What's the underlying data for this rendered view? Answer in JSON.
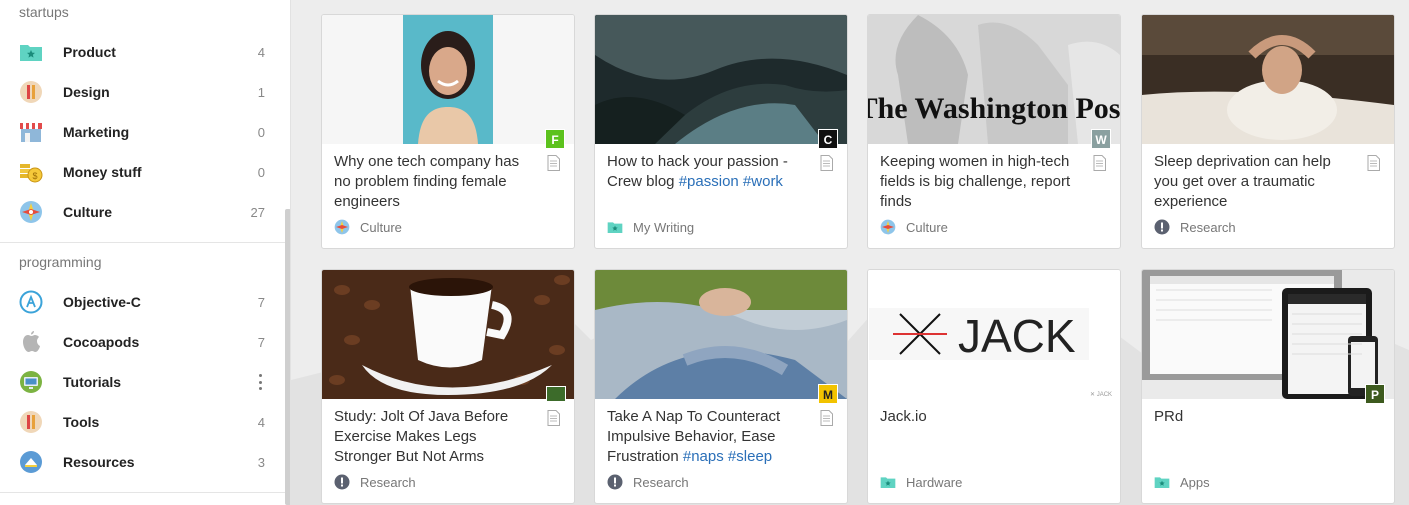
{
  "sidebar": {
    "sections": [
      {
        "header": "startups",
        "items": [
          {
            "label": "Product",
            "count": "4",
            "icon": "folder-star-icon"
          },
          {
            "label": "Design",
            "count": "1",
            "icon": "design-icon"
          },
          {
            "label": "Marketing",
            "count": "0",
            "icon": "storefront-icon"
          },
          {
            "label": "Money stuff",
            "count": "0",
            "icon": "coins-icon"
          },
          {
            "label": "Culture",
            "count": "27",
            "icon": "culture-icon"
          }
        ]
      },
      {
        "header": "programming",
        "items": [
          {
            "label": "Objective-C",
            "count": "7",
            "icon": "app-store-icon"
          },
          {
            "label": "Cocoapods",
            "count": "7",
            "icon": "apple-icon"
          },
          {
            "label": "Tutorials",
            "count": "",
            "icon": "monitor-icon"
          },
          {
            "label": "Tools",
            "count": "4",
            "icon": "tools-icon"
          },
          {
            "label": "Resources",
            "count": "3",
            "icon": "resources-icon"
          }
        ]
      }
    ]
  },
  "cards": [
    {
      "title": "Why one tech company has no problem finding female engineers",
      "tags": [],
      "badge": "F",
      "badge_color": "#5cc21d",
      "collection": "Culture",
      "collection_icon": "culture-icon"
    },
    {
      "title": "How to hack your passion - Crew blog",
      "tags": [
        "#passion",
        "#work"
      ],
      "badge": "C",
      "badge_color": "#111111",
      "collection": "My Writing",
      "collection_icon": "folder-star-icon"
    },
    {
      "title": "Keeping women in high-tech fields is big challenge, report finds",
      "tags": [],
      "badge": "W",
      "badge_color": "#8aa0a0",
      "collection": "Culture",
      "collection_icon": "culture-icon"
    },
    {
      "title": "Sleep deprivation can help you get over a traumatic experience",
      "tags": [],
      "badge": "",
      "badge_color": "",
      "collection": "Research",
      "collection_icon": "info-icon"
    },
    {
      "title": "Study: Jolt Of Java Before Exercise Makes Legs Stronger But Not Arms",
      "tags": [],
      "badge": "",
      "badge_color": "",
      "collection": "Research",
      "collection_icon": "info-icon"
    },
    {
      "title": "Take A Nap To Counteract Impulsive Behavior, Ease Frustration",
      "tags": [
        "#naps",
        "#sleep"
      ],
      "badge": "M",
      "badge_color": "#f2c300",
      "collection": "Research",
      "collection_icon": "info-icon"
    },
    {
      "title": "Jack.io",
      "tags": [],
      "badge": "",
      "badge_color": "",
      "collection": "Hardware",
      "collection_icon": "folder-star-icon",
      "thumb_text": "JACK",
      "thumb_small": "✕ JACK"
    },
    {
      "title": "PRd",
      "tags": [],
      "badge": "P",
      "badge_color": "#3d5a1e",
      "collection": "Apps",
      "collection_icon": "folder-star-icon"
    }
  ],
  "thumb_texts": {
    "washington_post": "The Washington Post"
  },
  "colors": {
    "tag": "#2a6fb8",
    "folder_teal": "#5fd3c2"
  }
}
